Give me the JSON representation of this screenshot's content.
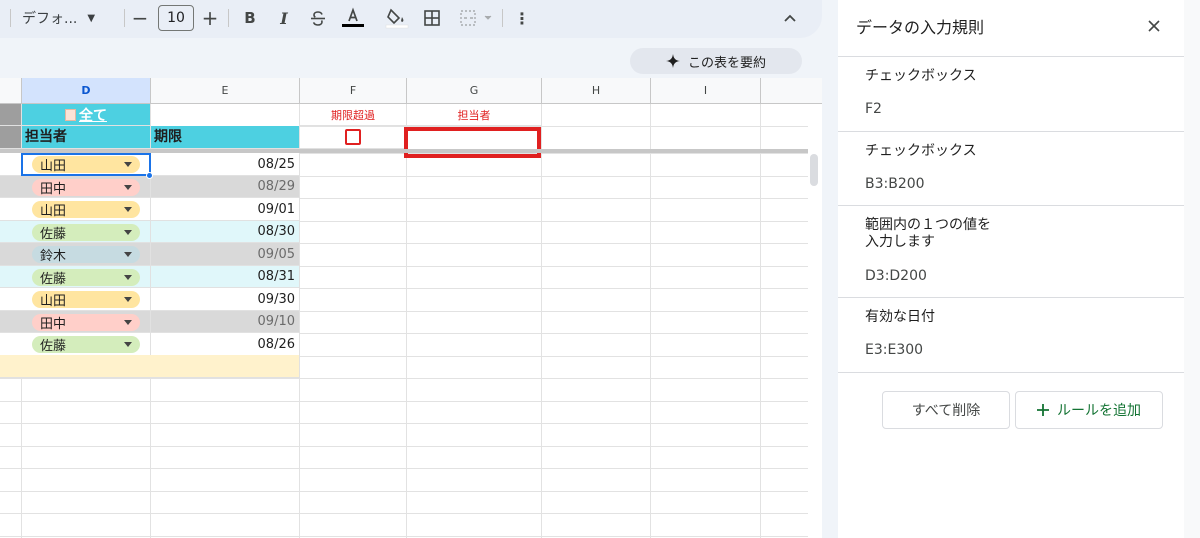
{
  "toolbar": {
    "font_name": "デフォ...",
    "font_size": "10",
    "minus": "−",
    "plus": "+",
    "bold": "B",
    "italic": "I"
  },
  "summarize_button": {
    "label": "この表を要約",
    "icon": "sparkle-icon"
  },
  "columns": [
    "D",
    "E",
    "F",
    "G",
    "H",
    "I"
  ],
  "header_rows": {
    "d1": "全て",
    "f1": "期限超過",
    "g1": "担当者",
    "d2": "担当者",
    "e2": "期限"
  },
  "rows": [
    {
      "person": "山田",
      "date": "08/25",
      "chip_color": "#ffe5a0",
      "row_bg": "#ffffff",
      "date_color": "#1f1f1f"
    },
    {
      "person": "田中",
      "date": "08/29",
      "chip_color": "#ffcfc9",
      "row_bg": "#d9d9d9",
      "date_color": "#6b6b6b"
    },
    {
      "person": "山田",
      "date": "09/01",
      "chip_color": "#ffe5a0",
      "row_bg": "#ffffff",
      "date_color": "#1f1f1f"
    },
    {
      "person": "佐藤",
      "date": "08/30",
      "chip_color": "#d4edbc",
      "row_bg": "#e0f7fa",
      "date_color": "#1f1f1f"
    },
    {
      "person": "鈴木",
      "date": "09/05",
      "chip_color": "#c6dbe1",
      "row_bg": "#d9d9d9",
      "date_color": "#6b6b6b"
    },
    {
      "person": "佐藤",
      "date": "08/31",
      "chip_color": "#d4edbc",
      "row_bg": "#e0f7fa",
      "date_color": "#1f1f1f"
    },
    {
      "person": "山田",
      "date": "09/30",
      "chip_color": "#ffe5a0",
      "row_bg": "#ffffff",
      "date_color": "#1f1f1f"
    },
    {
      "person": "田中",
      "date": "09/10",
      "chip_color": "#ffcfc9",
      "row_bg": "#d9d9d9",
      "date_color": "#6b6b6b"
    },
    {
      "person": "佐藤",
      "date": "08/26",
      "chip_color": "#d4edbc",
      "row_bg": "#ffffff",
      "date_color": "#1f1f1f"
    }
  ],
  "colors": {
    "header_cyan": "#4dd0e1",
    "accent_red": "#e02020",
    "selection_blue": "#1a73e8",
    "footer_row": "#fff2cc"
  },
  "panel": {
    "title": "データの入力規則",
    "rules": [
      {
        "title": "チェックボックス",
        "range": "F2"
      },
      {
        "title": "チェックボックス",
        "range": "B3:B200"
      },
      {
        "title_line1": "範囲内の１つの値を",
        "title_line2": "入力します",
        "range": "D3:D200"
      },
      {
        "title": "有効な日付",
        "range": "E3:E300"
      }
    ],
    "delete_all": "すべて削除",
    "add_rule": "ルールを追加"
  }
}
